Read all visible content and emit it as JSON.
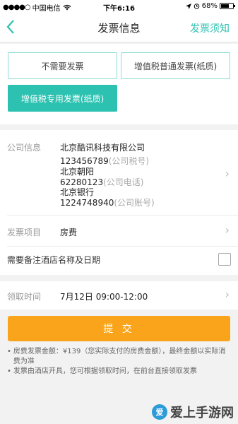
{
  "status_bar": {
    "signal": "●●●●○",
    "carrier": "中国电信",
    "wifi_icon": "wifi-icon",
    "time": "下午6:16",
    "location_icon": "location-arrow-icon",
    "alarm_icon": "alarm-icon",
    "battery_pct": "68%",
    "battery_level": 0.68
  },
  "nav": {
    "back_icon": "chevron-left-icon",
    "title": "发票信息",
    "right_link": "发票须知"
  },
  "invoice_types": {
    "options": [
      {
        "label": "不需要发票",
        "selected": false
      },
      {
        "label": "增值税普通发票(纸质)",
        "selected": false
      },
      {
        "label": "增值税专用发票(纸质)",
        "selected": true
      }
    ]
  },
  "company": {
    "label": "公司信息",
    "name": "北京酷讯科技有限公司",
    "tax_no": "123456789",
    "tax_no_hint": "(公司税号)",
    "address": "北京朝阳",
    "phone": "62280123",
    "phone_hint": "(公司电话)",
    "bank": "北京银行",
    "account": "1224748940",
    "account_hint": "(公司账号)"
  },
  "invoice_item": {
    "label": "发票项目",
    "value": "房费"
  },
  "note_option": {
    "label": "需要备注酒店名称及日期",
    "checked": false
  },
  "pickup": {
    "label": "领取时间",
    "value": "7月12日 09:00-12:00"
  },
  "submit_label": "提 交",
  "notes": [
    "房费发票金额：¥139（您实际支付的房费金额），最终金额以实际消费为准",
    "发票由酒店开具，您可根据领取时间，在前台直接领取发票"
  ],
  "watermark": {
    "logo": "爱",
    "text": "爱上手游网"
  },
  "colors": {
    "accent": "#2cc1b0",
    "submit": "#f9a41a"
  }
}
